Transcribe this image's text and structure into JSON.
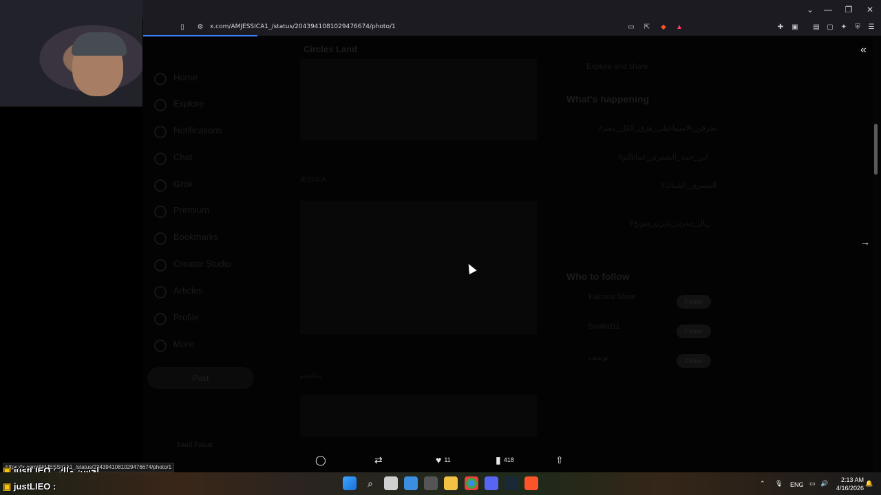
{
  "browser": {
    "url": "x.com/AMJESSICA1_/status/2043941081029476674/photo/1"
  },
  "sidebar": {
    "items": [
      {
        "label": "Home"
      },
      {
        "label": "Explore"
      },
      {
        "label": "Notifications"
      },
      {
        "label": "Chat"
      },
      {
        "label": "Grok"
      },
      {
        "label": "Premium"
      },
      {
        "label": "Bookmarks"
      },
      {
        "label": "Creator Studio"
      },
      {
        "label": "Articles"
      },
      {
        "label": "Profile"
      },
      {
        "label": "More"
      }
    ],
    "post_label": "Post",
    "account_name": "Saud Faisal"
  },
  "feed": {
    "title": "Circles Land",
    "tweet1_author": "JESSICA",
    "tweet2_author": "بنتكسجو"
  },
  "right_sidebar": {
    "explore_text": "Explore and share",
    "whats_happening": "What's happening",
    "trends": [
      "#تخرفن_الاسماعيلي_هزق_الكل_معم",
      "#ابن_حمد_الشمري_عماناكم",
      "#المصري_الشباك",
      "#ريال_مدريد_بايرن_ميونخ"
    ],
    "who_to_follow": "Who to follow",
    "follow_label": "Follow",
    "suggestions": [
      "Falcons Store",
      "Sealed11",
      "يوسف"
    ]
  },
  "viewer": {
    "likes": "11",
    "views": "418"
  },
  "status_link": "https://x.com/AMJESSICA1_/status/2043941081029476674/photo/1",
  "chat": [
    {
      "user": "justLIEO",
      "text": ": احسن ملك"
    },
    {
      "user": "justLIEO",
      "text": ":"
    }
  ],
  "system": {
    "language": "ENG",
    "time": "2:13 AM",
    "date": "4/16/2026"
  },
  "colors": {
    "accent": "#3d7fff",
    "background": "#000000",
    "text": "#e7e9ea"
  }
}
